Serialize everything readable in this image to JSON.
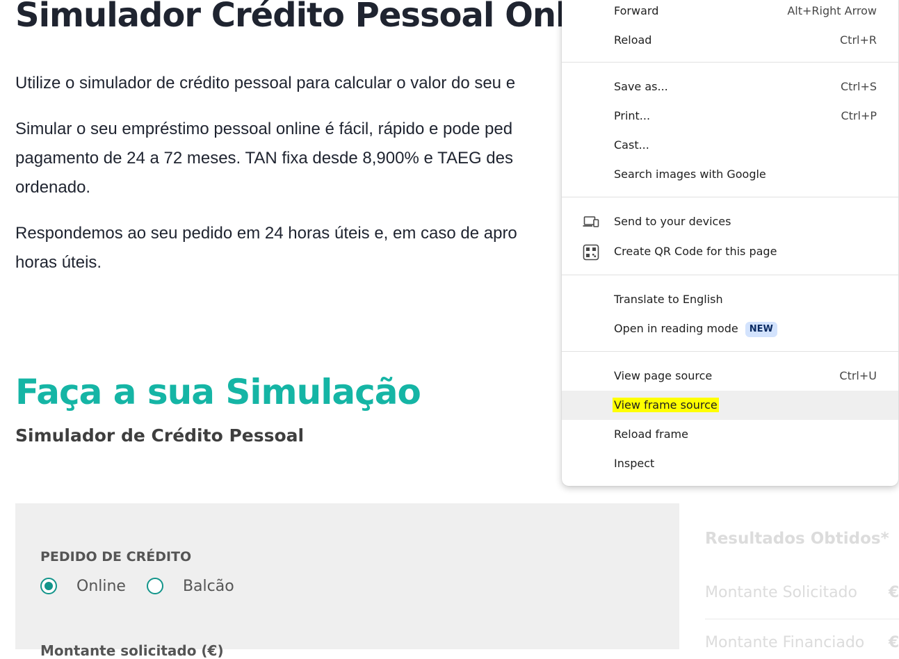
{
  "page": {
    "title": "Simulador Crédito Pessoal Onlin",
    "paragraphs": [
      [
        "Utilize o simulador de crédito pessoal para calcular o valor do seu e"
      ],
      [
        "Simular o seu empréstimo pessoal online é fácil, rápido e pode ped",
        "pagamento de 24 a 72 meses. TAN fixa desde 8,900% e TAEG des",
        "ordenado."
      ],
      [
        "Respondemos ao seu pedido em 24 horas úteis e, em caso de apro",
        "horas úteis."
      ]
    ],
    "simulation_title": "Faça a sua Simulação",
    "simulation_subtitle": "Simulador de Crédito Pessoal",
    "form": {
      "section_label": "PEDIDO DE CRÉDITO",
      "options": [
        {
          "label": "Online",
          "selected": true
        },
        {
          "label": "Balcão",
          "selected": false
        }
      ],
      "next_label_partial": "Montante solicitado (€)"
    },
    "results": {
      "title": "Resultados Obtidos*",
      "rows": [
        {
          "label": "Montante Solicitado",
          "currency": "€"
        },
        {
          "label": "Montante Financiado",
          "currency": "€"
        }
      ]
    }
  },
  "context_menu": {
    "items": [
      {
        "label": "Forward",
        "shortcut": "Alt+Right Arrow"
      },
      {
        "label": "Reload",
        "shortcut": "Ctrl+R"
      },
      {
        "label": "Save as...",
        "shortcut": "Ctrl+S"
      },
      {
        "label": "Print...",
        "shortcut": "Ctrl+P"
      },
      {
        "label": "Cast...",
        "shortcut": ""
      },
      {
        "label": "Search images with Google",
        "shortcut": ""
      },
      {
        "label": "Send to your devices",
        "shortcut": "",
        "icon": "devices-icon"
      },
      {
        "label": "Create QR Code for this page",
        "shortcut": "",
        "icon": "qr-code-icon"
      },
      {
        "label": "Translate to English",
        "shortcut": ""
      },
      {
        "label": "Open in reading mode",
        "shortcut": "",
        "badge": "NEW"
      },
      {
        "label": "View page source",
        "shortcut": "Ctrl+U"
      },
      {
        "label": "View frame source",
        "shortcut": "",
        "highlighted": true
      },
      {
        "label": "Reload frame",
        "shortcut": ""
      },
      {
        "label": "Inspect",
        "shortcut": ""
      }
    ]
  }
}
